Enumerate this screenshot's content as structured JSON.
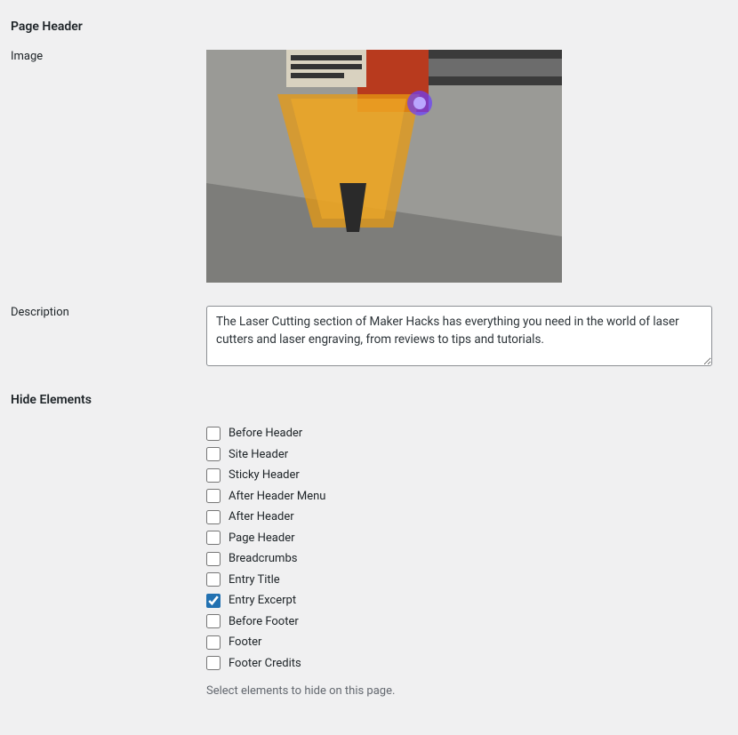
{
  "page_header": {
    "heading": "Page Header",
    "image_label": "Image",
    "description_label": "Description",
    "description_value": "The Laser Cutting section of Maker Hacks has everything you need in the world of laser cutters and laser engraving, from reviews to tips and tutorials."
  },
  "hide_elements": {
    "heading": "Hide Elements",
    "help_text": "Select elements to hide on this page.",
    "items": [
      {
        "key": "before_header",
        "label": "Before Header",
        "checked": false
      },
      {
        "key": "site_header",
        "label": "Site Header",
        "checked": false
      },
      {
        "key": "sticky_header",
        "label": "Sticky Header",
        "checked": false
      },
      {
        "key": "after_header_menu",
        "label": "After Header Menu",
        "checked": false
      },
      {
        "key": "after_header",
        "label": "After Header",
        "checked": false
      },
      {
        "key": "page_header",
        "label": "Page Header",
        "checked": false
      },
      {
        "key": "breadcrumbs",
        "label": "Breadcrumbs",
        "checked": false
      },
      {
        "key": "entry_title",
        "label": "Entry Title",
        "checked": false
      },
      {
        "key": "entry_excerpt",
        "label": "Entry Excerpt",
        "checked": true
      },
      {
        "key": "before_footer",
        "label": "Before Footer",
        "checked": false
      },
      {
        "key": "footer",
        "label": "Footer",
        "checked": false
      },
      {
        "key": "footer_credits",
        "label": "Footer Credits",
        "checked": false
      }
    ]
  }
}
